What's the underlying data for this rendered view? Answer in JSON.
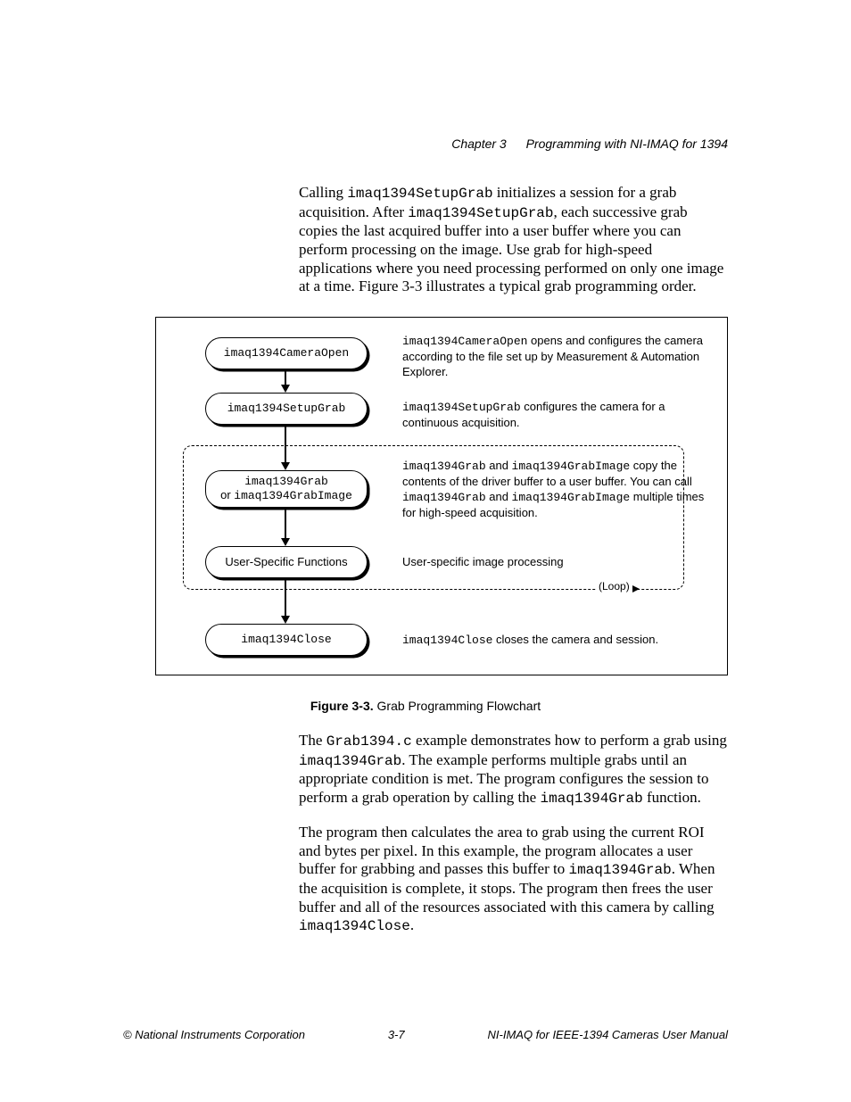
{
  "header": {
    "chapter": "Chapter 3",
    "title": "Programming with NI-IMAQ for 1394"
  },
  "para1": {
    "t1": "Calling ",
    "c1": "imaq1394SetupGrab",
    "t2": " initializes a session for a grab acquisition. After ",
    "c2": "imaq1394SetupGrab",
    "t3": ", each successive grab copies the last acquired buffer into a user buffer where you can perform processing on the image. Use grab for high-speed applications where you need processing performed on only one image at a time. Figure 3-3 illustrates a typical grab programming order."
  },
  "figure": {
    "box1": "imaq1394CameraOpen",
    "box2": "imaq1394SetupGrab",
    "box3a": "imaq1394Grab",
    "box3or": "or ",
    "box3b": "imaq1394GrabImage",
    "box4": "User-Specific Functions",
    "box5": "imaq1394Close",
    "loop": "(Loop)",
    "d1a": "imaq1394CameraOpen",
    "d1b": " opens and configures the camera according to the file set up by Measurement & Automation Explorer.",
    "d2a": "imaq1394SetupGrab",
    "d2b": " configures the camera for a continuous acquisition.",
    "d3a": "imaq1394Grab",
    "d3b": " and ",
    "d3c": "imaq1394GrabImage",
    "d3d": " copy the contents of the driver buffer to a user buffer. You can call ",
    "d3e": "imaq1394Grab",
    "d3f": " and ",
    "d3g": "imaq1394GrabImage",
    "d3h": " multiple times for high-speed acquisition.",
    "d4": "User-specific image processing",
    "d5a": "imaq1394Close",
    "d5b": " closes the camera and session."
  },
  "figcap": {
    "label": "Figure 3-3.",
    "text": "  Grab Programming Flowchart"
  },
  "para2": {
    "t1": "The ",
    "c1": "Grab1394.c",
    "t2": " example demonstrates how to perform a grab using ",
    "c2": "imaq1394Grab",
    "t3": ". The example performs multiple grabs until an appropriate condition is met. The program configures the session to perform a grab operation by calling the ",
    "c3": "imaq1394Grab",
    "t4": " function."
  },
  "para3": {
    "t1": "The program then calculates the area to grab using the current ROI and bytes per pixel. In this example, the program allocates a user buffer for grabbing and passes this buffer to ",
    "c1": "imaq1394Grab",
    "t2": ". When the acquisition is complete, it stops. The program then frees the user buffer and all of the resources associated with this camera by calling ",
    "c2": "imaq1394Close",
    "t3": "."
  },
  "footer": {
    "left": "© National Instruments Corporation",
    "center": "3-7",
    "right": "NI-IMAQ for IEEE-1394 Cameras User Manual"
  }
}
